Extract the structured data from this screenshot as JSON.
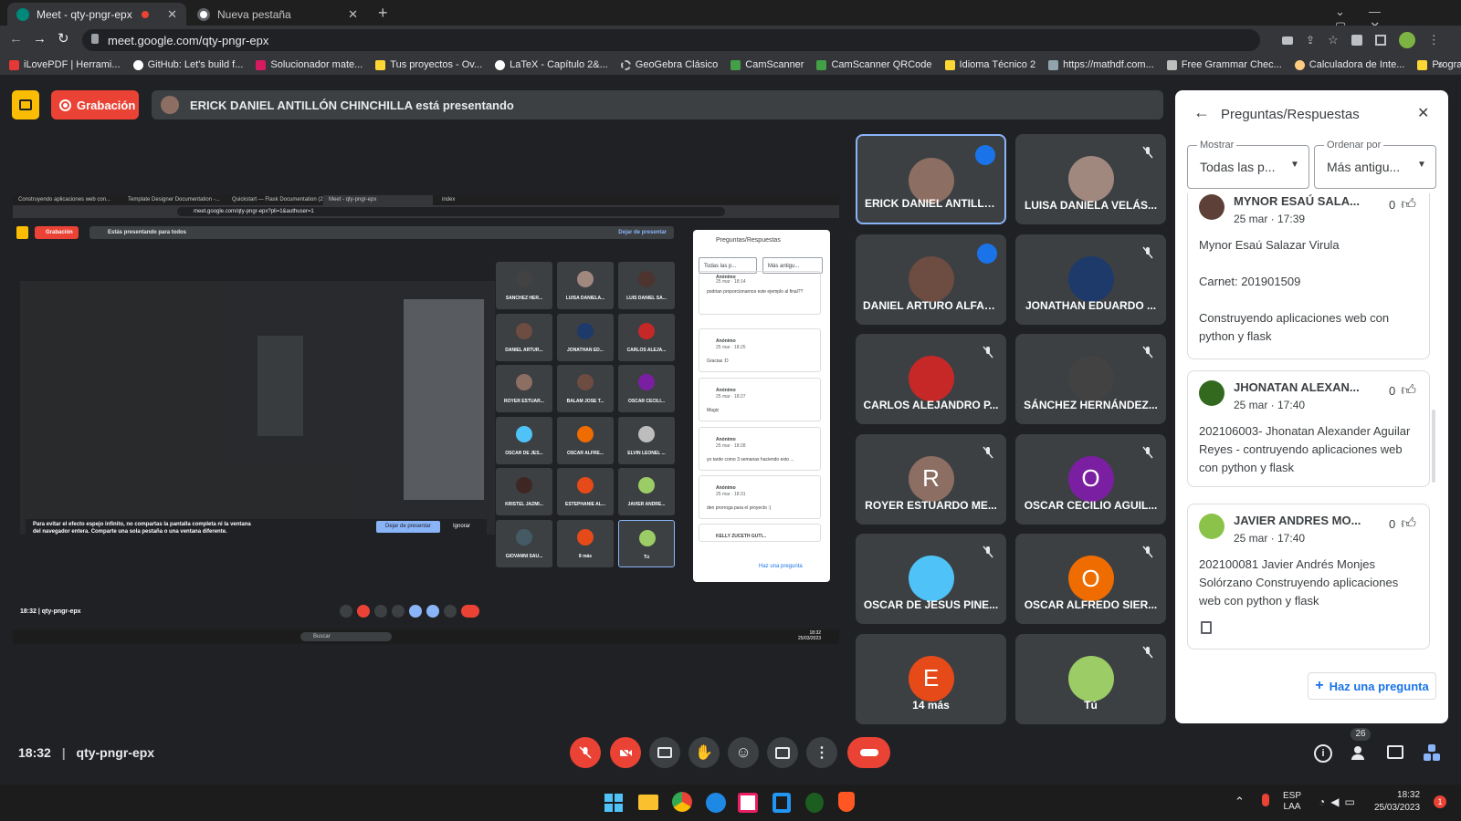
{
  "browser": {
    "tabs": [
      {
        "title": "Meet - qty-pngr-epx",
        "active": true
      },
      {
        "title": "Nueva pestaña",
        "active": false
      }
    ],
    "url": "meet.google.com/qty-pngr-epx",
    "bookmarks": [
      "iLovePDF | Herrami...",
      "GitHub: Let's build f...",
      "Solucionador mate...",
      "Tus proyectos - Ov...",
      "LaTeX - Capítulo 2&...",
      "GeoGebra Clásico",
      "CamScanner",
      "CamScanner QRCode",
      "Idioma Técnico 2",
      "https://mathdf.com...",
      "Free Grammar Chec...",
      "Calculadora de Inte...",
      "Programar"
    ]
  },
  "meet": {
    "recording_label": "Grabación",
    "presenting_text": "ERICK DANIEL ANTILLÓN CHINCHILLA está presentando",
    "time": "18:32",
    "meeting_code": "qty-pngr-epx",
    "participants_count": "26",
    "tiles": [
      {
        "name": "ERICK DANIEL ANTILLÓ...",
        "avatar_color": "#8d6e63",
        "speaking": true
      },
      {
        "name": "LUISA DANIELA VELÁS...",
        "avatar_color": "#a1887f"
      },
      {
        "name": "DANIEL ARTURO ALFAR...",
        "avatar_color": "#6d4c41",
        "active_audio": true
      },
      {
        "name": "JONATHAN EDUARDO ...",
        "avatar_color": "#1e3a6b"
      },
      {
        "name": "CARLOS ALEJANDRO P...",
        "avatar_color": "#c62828"
      },
      {
        "name": "SÁNCHEZ HERNÁNDEZ...",
        "avatar_color": "#424242"
      },
      {
        "name": "ROYER ESTUARDO ME...",
        "avatar_letter": "R",
        "avatar_color": "#8d6e63"
      },
      {
        "name": "OSCAR CECILIO AGUIL...",
        "avatar_letter": "O",
        "avatar_color": "#7b1fa2"
      },
      {
        "name": "OSCAR DE JESUS PINE...",
        "avatar_color": "#4fc3f7"
      },
      {
        "name": "OSCAR ALFREDO SIER...",
        "avatar_letter": "O",
        "avatar_color": "#ef6c00"
      },
      {
        "name": "14 más",
        "avatar_letter": "E",
        "avatar_color": "#e64a19"
      },
      {
        "name": "Tú",
        "avatar_color": "#9ccc65"
      }
    ]
  },
  "panel": {
    "title": "Preguntas/Respuestas",
    "filter_label": "Mostrar",
    "filter_value": "Todas las p...",
    "sort_label": "Ordenar por",
    "sort_value": "Más antigu...",
    "ask_button": "Haz una pregunta",
    "questions": [
      {
        "author": "MYNOR ESAÚ SALA...",
        "time": "25 mar · 17:39",
        "likes": "0",
        "lines": [
          "Mynor Esaú Salazar Virula",
          "",
          "Carnet: 201901509",
          "",
          "Construyendo aplicaciones web con python y flask"
        ]
      },
      {
        "author": "JHONATAN ALEXAN...",
        "time": "25 mar · 17:40",
        "likes": "0",
        "lines": [
          "202106003- Jhonatan Alexander Aguilar Reyes - contruyendo aplicaciones web con python y flask"
        ]
      },
      {
        "author": "JAVIER ANDRES MO...",
        "time": "25 mar · 17:40",
        "likes": "0",
        "lines": [
          "202100081 Javier Andrés Monjes Solórzano Construyendo aplicaciones web con python y flask"
        ]
      }
    ]
  },
  "shared_screen": {
    "tabs": [
      "Construyendo aplicaciones web con...",
      "Template Designer Documentation -...",
      "Quickstart — Flask Documentation (2...",
      "Meet - qty-pngr-epx",
      "index"
    ],
    "url": "meet.google.com/qty-pngr-epx?pli=1&authuser=1",
    "recording_label": "Grabación",
    "presenting_text": "Estás presentando para todos",
    "stop_presenting": "Dejar de presentar",
    "warning": "Para evitar el efecto espejo infinito, no compartas la pantalla completa ni la ventana del navegador entera. Comparte una sola pestaña o una ventana diferente.",
    "stop_button": "Dejar de presentar",
    "ignore_button": "Ignorar",
    "time": "18:32",
    "code": "qty-pngr-epx",
    "panel_title": "Preguntas/Respuestas",
    "panel_filter": "Todas las p...",
    "panel_sort": "Más antigu...",
    "panel_ask": "Haz una pregunta",
    "questions": [
      {
        "author": "Anónimo",
        "time": "25 mar · 18:14",
        "text": "podrian proporcionarnos este ejemplo al final??"
      },
      {
        "author": "Anónimo",
        "time": "25 mar · 18:25",
        "text": "Gracias :D"
      },
      {
        "author": "Anónimo",
        "time": "25 mar · 18:27",
        "text": "Magic"
      },
      {
        "author": "Anónimo",
        "time": "25 mar · 18:28",
        "text": "yo tarde como 3 semanas haciendo esto ..."
      },
      {
        "author": "Anónimo",
        "time": "25 mar · 18:31",
        "text": "den prorroga para el proyecto :("
      },
      {
        "author": "KELLY ZUCETH GUTI...",
        "time": "",
        "text": ""
      }
    ],
    "tiles": [
      "SÁNCHEZ HER...",
      "LUISA DANIELA...",
      "LUIS DANIEL SA...",
      "DANIEL ARTUR...",
      "JONATHAN ED...",
      "CARLOS ALEJA...",
      "ROYER ESTUAR...",
      "BALAM JOSE T...",
      "OSCAR CECILI...",
      "OSCAR DE JES...",
      "OSCAR ALFRE...",
      "ELVIN LEONEL ...",
      "KRISTEL JAZMI...",
      "ESTEPHANIE AL...",
      "JAVIER ANDRE...",
      "GIOVANNI SAU...",
      "8 más",
      "Tú"
    ],
    "taskbar_search": "Buscar",
    "clock_time": "18:32",
    "clock_date": "25/03/2023"
  },
  "taskbar": {
    "lang": "ESP",
    "lang2": "LAA",
    "time": "18:32",
    "date": "25/03/2023",
    "notif": "1"
  }
}
